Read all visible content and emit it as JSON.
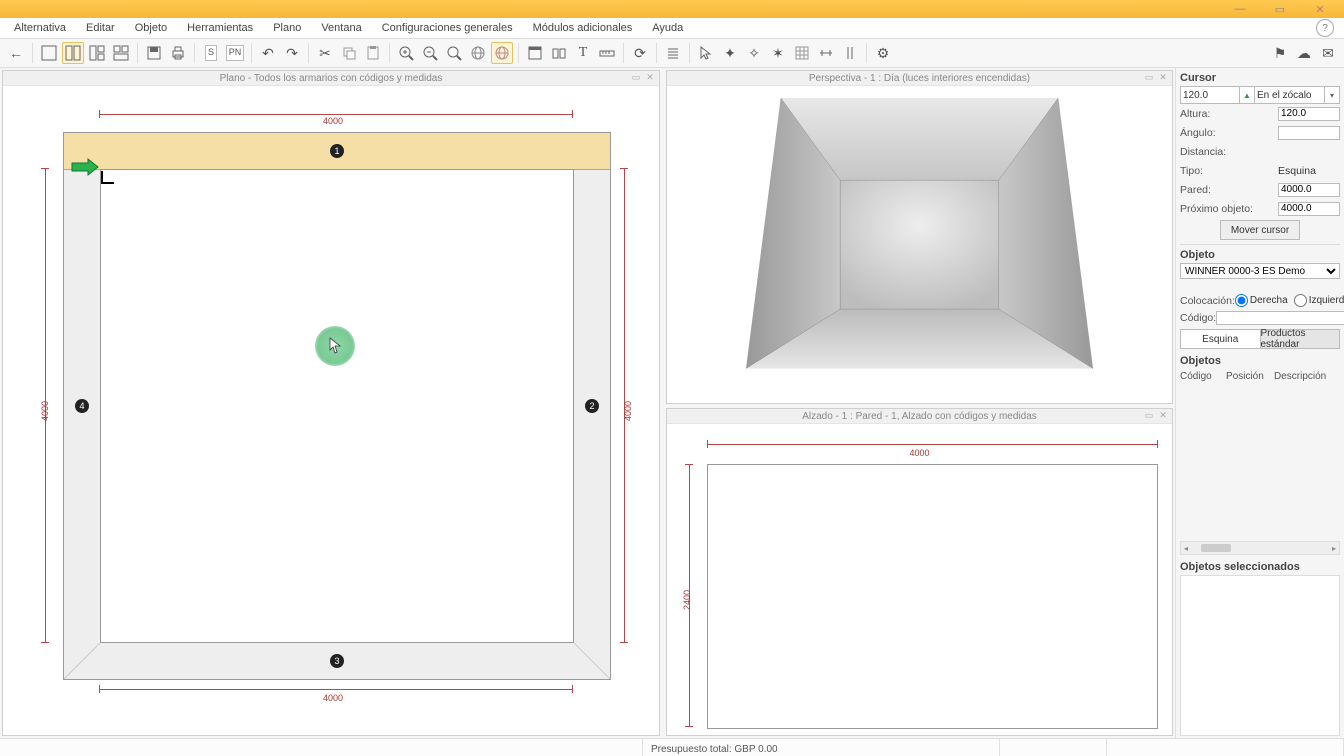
{
  "titlebar": {
    "title": ""
  },
  "menu": {
    "items": [
      "Alternativa",
      "Editar",
      "Objeto",
      "Herramientas",
      "Plano",
      "Ventana",
      "Configuraciones generales",
      "Módulos adicionales",
      "Ayuda"
    ]
  },
  "frames": {
    "plan": {
      "title": "Plano - Todos los armarios con códigos y medidas",
      "dim_top": "4000",
      "dim_bottom": "4000",
      "dim_left": "4000",
      "dim_right": "4000",
      "wall1": "1",
      "wall2": "2",
      "wall3": "3",
      "wall4": "4"
    },
    "persp": {
      "title": "Perspectiva - 1 : Día (luces interiores encendidas)"
    },
    "elev": {
      "title": "Alzado - 1 : Pared - 1, Alzado con códigos y medidas",
      "dim_top": "4000",
      "dim_left": "2400"
    }
  },
  "side": {
    "cursor": {
      "title": "Cursor",
      "pos_value": "120.0",
      "pos_mode": "En el zócalo",
      "height_label": "Altura:",
      "height_value": "120.0",
      "angle_label": "Ángulo:",
      "angle_value": "",
      "dist_label": "Distancia:",
      "type_label": "Tipo:",
      "type_value": "Esquina",
      "wall_label": "Pared:",
      "wall_value": "4000.0",
      "next_label": "Próximo objeto:",
      "next_value": "4000.0",
      "move_btn": "Mover cursor"
    },
    "object": {
      "title": "Objeto",
      "catalog": "WINNER 0000-3 ES Demo",
      "placement_label": "Colocación:",
      "placement_right": "Derecha",
      "placement_left": "Izquierda",
      "code_label": "Código:",
      "code_value": "",
      "tab_corner": "Esquina",
      "tab_standard": "Productos estándar"
    },
    "objects": {
      "title": "Objetos",
      "col_code": "Código",
      "col_pos": "Posición",
      "col_desc": "Descripción"
    },
    "selected": {
      "title": "Objetos seleccionados"
    }
  },
  "status": {
    "budget": "Presupuesto total: GBP 0.00"
  }
}
